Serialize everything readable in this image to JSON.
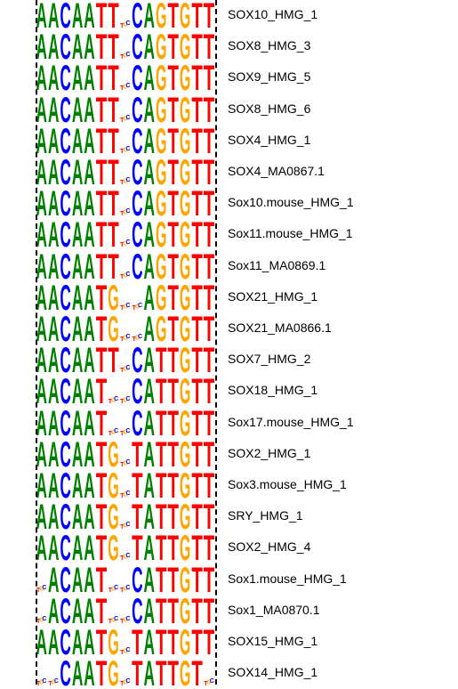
{
  "colors": {
    "A": "#008000",
    "C": "#0000ff",
    "G": "#ffa500",
    "T": "#ff0000",
    "divider": "#000000",
    "label": "#000000"
  },
  "motifs": [
    {
      "name": "SOX10_HMG_1",
      "logo": "AACAATT.CAGTGTT"
    },
    {
      "name": "SOX8_HMG_3",
      "logo": "AACAATT.CAGTGTT"
    },
    {
      "name": "SOX9_HMG_5",
      "logo": "AACAATT.CAGTGTT"
    },
    {
      "name": "SOX8_HMG_6",
      "logo": "AACAATT.CAGTGTT"
    },
    {
      "name": "SOX4_HMG_1",
      "logo": "AACAATT.CAGTGTT"
    },
    {
      "name": "SOX4_MA0867.1",
      "logo": "AACAATT.CAGTGTT"
    },
    {
      "name": "Sox10.mouse_HMG_1",
      "logo": "AACAATT.CAGTGTT"
    },
    {
      "name": "Sox11.mouse_HMG_1",
      "logo": "AACAATT.CAGTGTT"
    },
    {
      "name": "Sox11_MA0869.1",
      "logo": "AACAATT.CAGTGTT"
    },
    {
      "name": "SOX21_HMG_1",
      "logo": "AACAATG..AGTGTT"
    },
    {
      "name": "SOX21_MA0866.1",
      "logo": "AACAATG..AGTGTT"
    },
    {
      "name": "SOX7_HMG_2",
      "logo": "AACAATT.CATTGTT"
    },
    {
      "name": "SOX18_HMG_1",
      "logo": "AACAAT..CATTGTT"
    },
    {
      "name": "Sox17.mouse_HMG_1",
      "logo": "AACAAT..CATTGTT"
    },
    {
      "name": "SOX2_HMG_1",
      "logo": "AACAATG.TATTGTT"
    },
    {
      "name": "Sox3.mouse_HMG_1",
      "logo": "AACAATG.TATTGTT"
    },
    {
      "name": "SRY_HMG_1",
      "logo": "AACAATG.TATTGTT"
    },
    {
      "name": "SOX2_HMG_4",
      "logo": "AACAATG.TATTGTT"
    },
    {
      "name": "Sox1.mouse_HMG_1",
      "logo": ".ACAAT..CATTGTT"
    },
    {
      "name": "Sox1_MA0870.1",
      "logo": ".ACAAT..CATTGTT"
    },
    {
      "name": "SOX15_HMG_1",
      "logo": "AACAATG.TATTGTT"
    },
    {
      "name": "SOX14_HMG_1",
      "logo": "..CAATG.TATTGT."
    }
  ]
}
